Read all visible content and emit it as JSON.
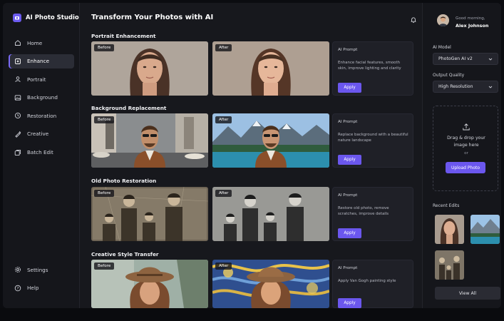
{
  "app": {
    "name": "AI Photo Studio"
  },
  "nav": {
    "items": [
      {
        "label": "Home",
        "icon": "home-icon"
      },
      {
        "label": "Enhance",
        "icon": "sparkle-icon"
      },
      {
        "label": "Portrait",
        "icon": "portrait-icon"
      },
      {
        "label": "Background",
        "icon": "background-icon"
      },
      {
        "label": "Restoration",
        "icon": "restore-icon"
      },
      {
        "label": "Creative",
        "icon": "palette-icon"
      },
      {
        "label": "Batch Edit",
        "icon": "batch-icon"
      }
    ],
    "active_index": 1,
    "bottom": [
      {
        "label": "Settings",
        "icon": "gear-icon"
      },
      {
        "label": "Help",
        "icon": "help-icon"
      }
    ]
  },
  "main": {
    "title": "Transform Your Photos with AI",
    "sections": [
      {
        "title": "Portrait Enhancement",
        "before": "Before",
        "after": "After",
        "prompt_label": "AI Prompt",
        "prompt": "Enhance facial features, smooth skin, improve lighting and clarity",
        "apply": "Apply"
      },
      {
        "title": "Background Replacement",
        "before": "Before",
        "after": "After",
        "prompt_label": "AI Prompt",
        "prompt": "Replace background with a beautiful nature landscape",
        "apply": "Apply"
      },
      {
        "title": "Old Photo Restoration",
        "before": "Before",
        "after": "After",
        "prompt_label": "AI Prompt",
        "prompt": "Restore old photo, remove scratches, improve details",
        "apply": "Apply"
      },
      {
        "title": "Creative Style Transfer",
        "before": "Before",
        "after": "After",
        "prompt_label": "AI Prompt",
        "prompt": "Apply Van Gogh painting style",
        "apply": "Apply"
      }
    ]
  },
  "right": {
    "greeting": "Good morning,",
    "user": "Alex Johnson",
    "model_label": "AI Model",
    "model_value": "PhotoGen AI v2",
    "quality_label": "Output Quality",
    "quality_value": "High Resolution",
    "upload_text_1": "Drag & drop your",
    "upload_text_2": "image here",
    "upload_or": "or",
    "upload_button": "Upload Photo",
    "recent_label": "Recent Edits",
    "view_all": "View All"
  },
  "colors": {
    "accent": "#6b57ee",
    "bg": "#17181d",
    "panel": "#15161b"
  }
}
